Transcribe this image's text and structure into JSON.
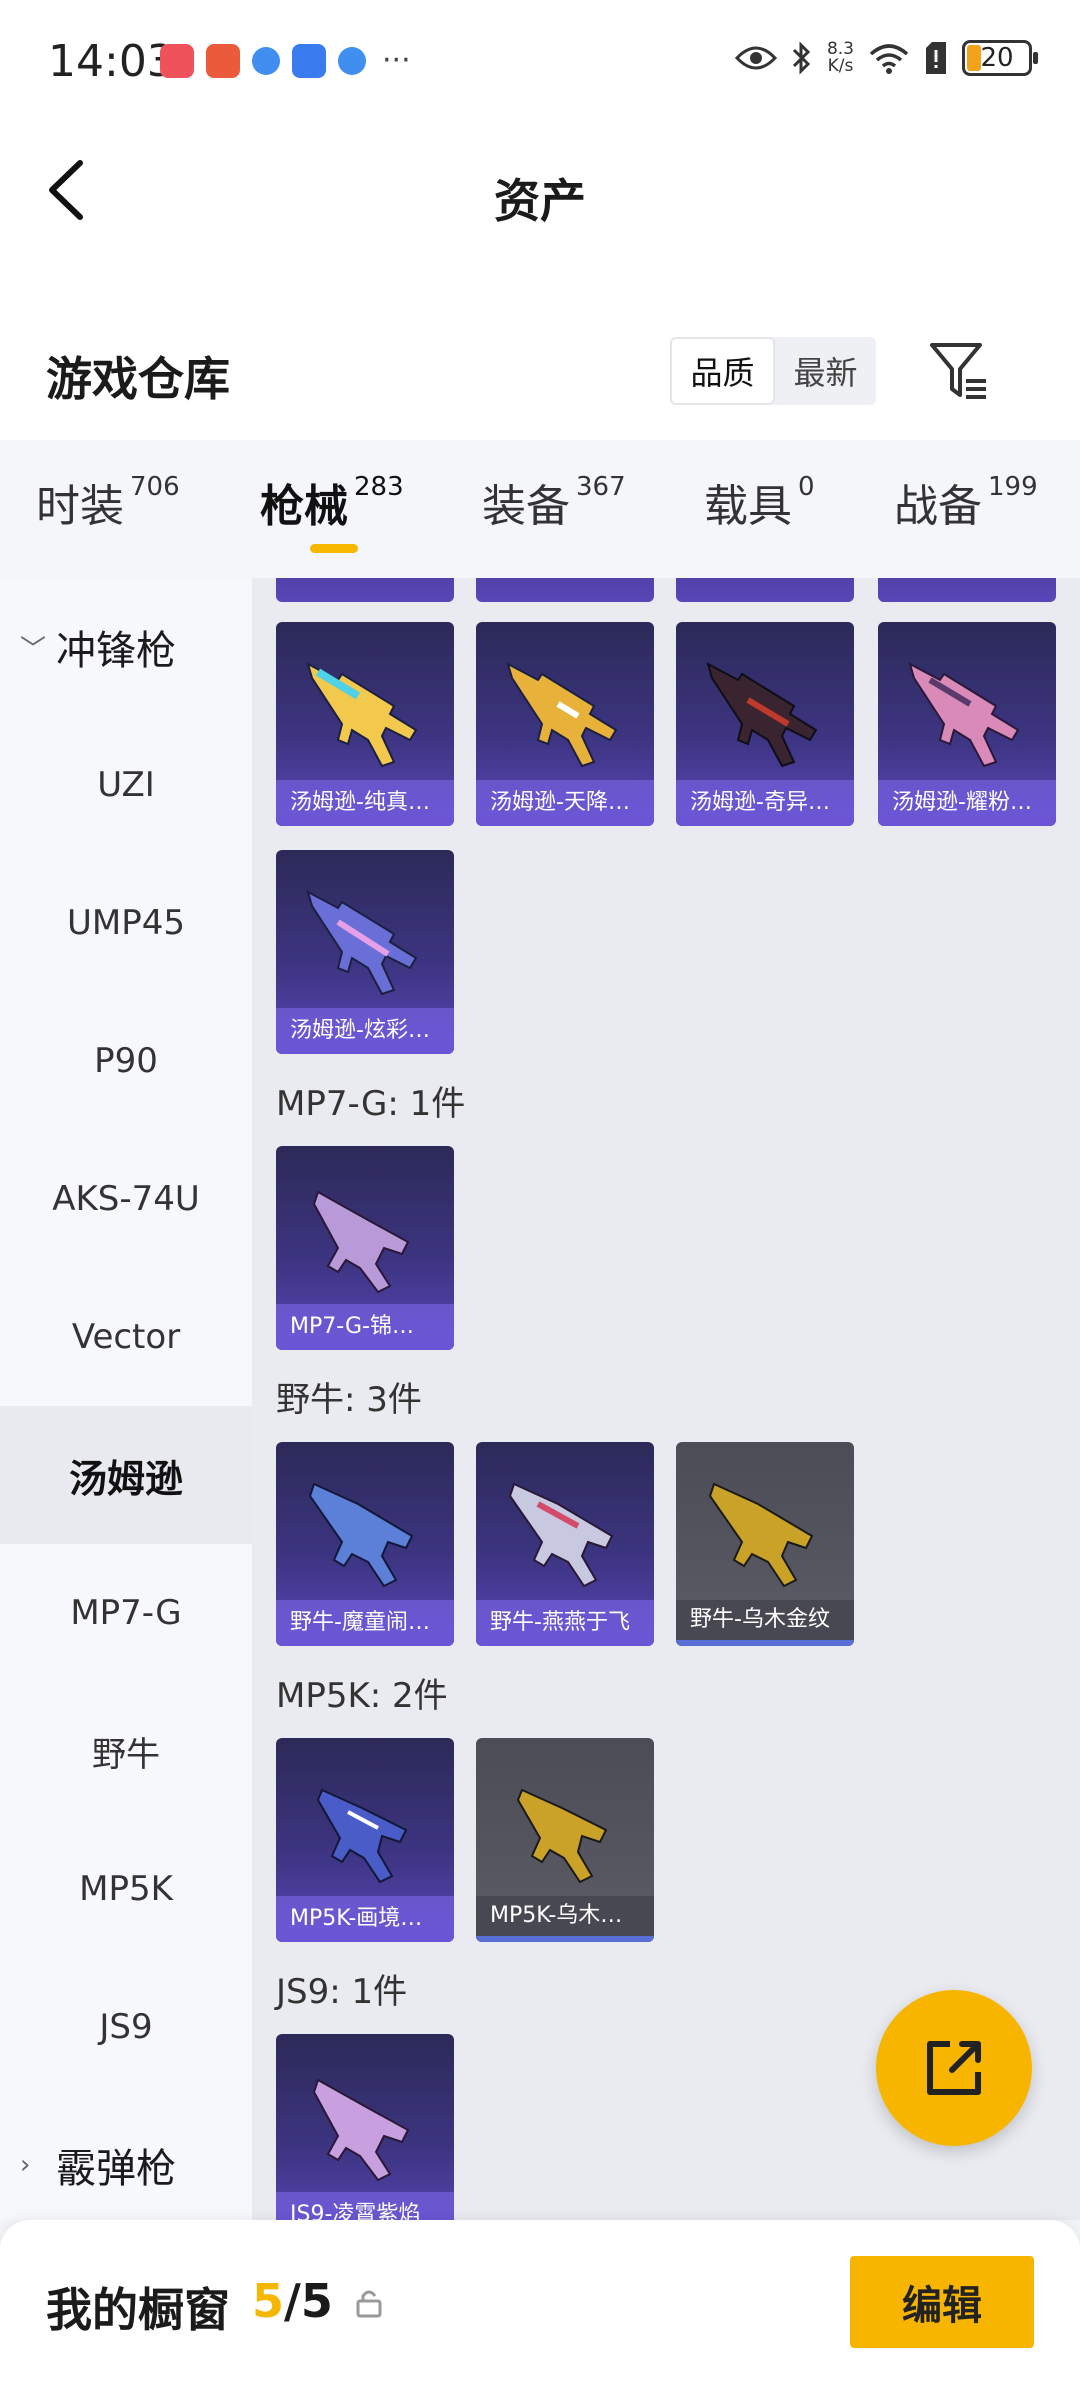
{
  "status_bar": {
    "time": "14:03",
    "net_speed_value": "8.3",
    "net_speed_unit": "K/s",
    "battery": "20",
    "overflow": "···"
  },
  "header": {
    "title": "资产"
  },
  "warehouse": {
    "title": "游戏仓库",
    "sort_options": [
      "品质",
      "最新"
    ],
    "sort_selected": "品质"
  },
  "tabs": [
    {
      "label": "时装",
      "count": "706"
    },
    {
      "label": "枪械",
      "count": "283",
      "active": true
    },
    {
      "label": "装备",
      "count": "367"
    },
    {
      "label": "载具",
      "count": "0"
    },
    {
      "label": "战备",
      "count": "199"
    }
  ],
  "sidebar": {
    "group_smg": "冲锋枪",
    "items": [
      "UZI",
      "UMP45",
      "P90",
      "AKS-74U",
      "Vector",
      "汤姆逊",
      "MP7-G",
      "野牛",
      "MP5K",
      "JS9"
    ],
    "selected": "汤姆逊",
    "group_shotgun": "霰弹枪"
  },
  "content": {
    "thompson_cards": [
      "汤姆逊-纯真…",
      "汤姆逊-天降…",
      "汤姆逊-奇异…",
      "汤姆逊-耀粉…",
      "汤姆逊-炫彩…"
    ],
    "mp7_label": "MP7-G: 1件",
    "mp7_cards": [
      "MP7-G-锦…"
    ],
    "bizon_label": "野牛: 3件",
    "bizon_cards": [
      "野牛-魔童闹…",
      "野牛-燕燕于飞",
      "野牛-乌木金纹"
    ],
    "mp5k_label": "MP5K: 2件",
    "mp5k_cards": [
      "MP5K-画境…",
      "MP5K-乌木…"
    ],
    "js9_label": "JS9: 1件",
    "js9_cards": [
      "JS9-凌霄紫焰"
    ]
  },
  "bottom": {
    "label": "我的橱窗",
    "current": "5",
    "sep_total": "/5",
    "edit": "编辑"
  },
  "colors": {
    "accent": "#f8b500",
    "card_purple": "#5a46b8"
  }
}
